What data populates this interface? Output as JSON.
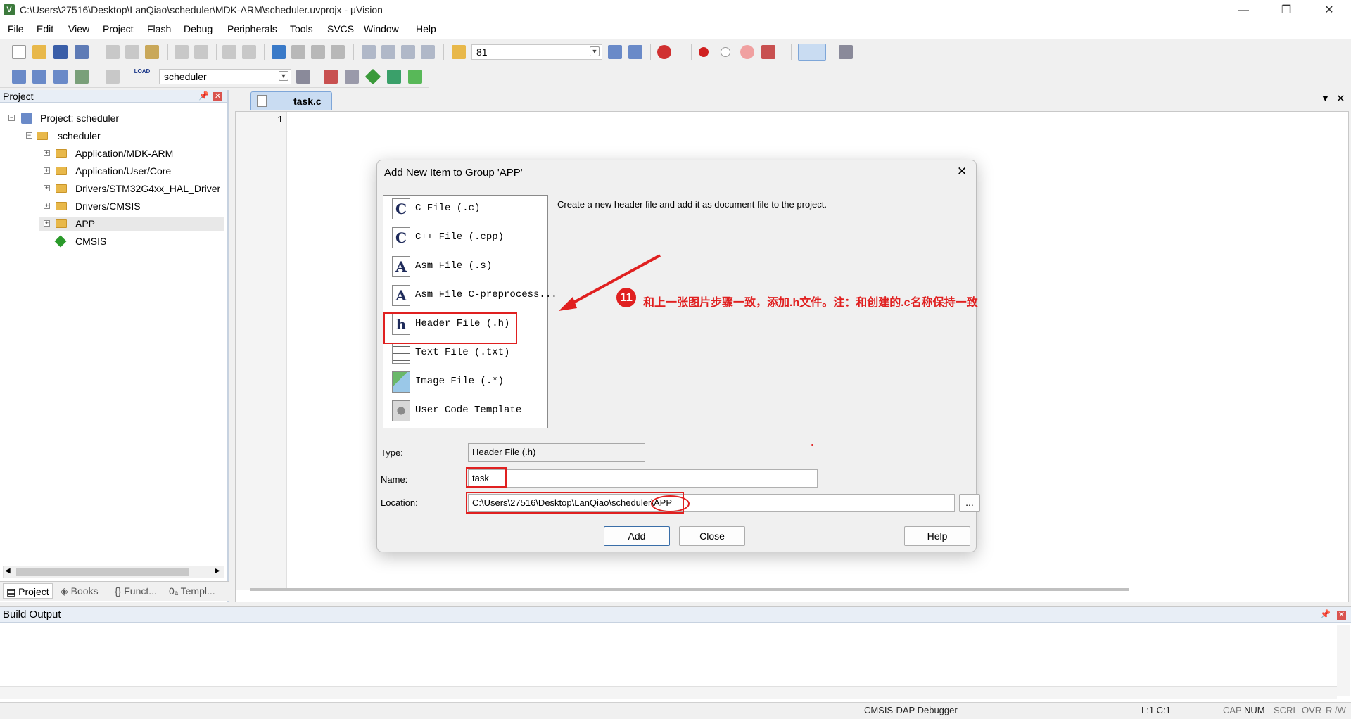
{
  "window": {
    "title": "C:\\Users\\27516\\Desktop\\LanQiao\\scheduler\\MDK-ARM\\scheduler.uvprojx - µVision",
    "app_icon_glyph": "V",
    "minimize": "—",
    "restore": "❐",
    "close": "✕"
  },
  "menu": [
    "File",
    "Edit",
    "View",
    "Project",
    "Flash",
    "Debug",
    "Peripherals",
    "Tools",
    "SVCS",
    "Window",
    "Help"
  ],
  "toolbar": {
    "find_value": "81",
    "target_value": "scheduler",
    "load_label": "LOAD"
  },
  "project_panel": {
    "title": "Project",
    "tree": {
      "root": "Project: scheduler",
      "target": "scheduler",
      "groups": [
        "Application/MDK-ARM",
        "Application/User/Core",
        "Drivers/STM32G4xx_HAL_Driver",
        "Drivers/CMSIS",
        "APP",
        "CMSIS"
      ]
    },
    "tabs": [
      "Project",
      "Books",
      "{} Funct...",
      "0ₐ Templ..."
    ]
  },
  "editor": {
    "tab_label": "task.c",
    "line_number": "1"
  },
  "dialog": {
    "title": "Add New Item to Group 'APP'",
    "description": "Create a new header file and add it as document file to the project.",
    "items": [
      {
        "label": "C File (.c)",
        "icon": "C"
      },
      {
        "label": "C++ File (.cpp)",
        "icon": "C"
      },
      {
        "label": "Asm File (.s)",
        "icon": "A"
      },
      {
        "label": "Asm File C-preprocess...",
        "icon": "A"
      },
      {
        "label": "Header File (.h)",
        "icon": "h"
      },
      {
        "label": "Text File (.txt)",
        "icon": "text-file-icon"
      },
      {
        "label": "Image File (.*)",
        "icon": "image-file-icon"
      },
      {
        "label": "User Code Template",
        "icon": "template-icon"
      }
    ],
    "type_label": "Type:",
    "type_value": "Header File (.h)",
    "name_label": "Name:",
    "name_value": "task",
    "location_label": "Location:",
    "location_value": "C:\\Users\\27516\\Desktop\\LanQiao\\scheduler\\APP",
    "browse_label": "...",
    "add_label": "Add",
    "close_label": "Close",
    "help_label": "Help"
  },
  "annotation": {
    "step_number": "11",
    "text": "和上一张图片步骤一致，添加.h文件。注：和创建的.c名称保持一致",
    "color": "#e02020"
  },
  "build_output": {
    "title": "Build Output"
  },
  "status_bar": {
    "debugger": "CMSIS-DAP Debugger",
    "position": "L:1 C:1",
    "indicators": [
      "CAP",
      "NUM",
      "SCRL",
      "OVR",
      "R /W"
    ]
  }
}
